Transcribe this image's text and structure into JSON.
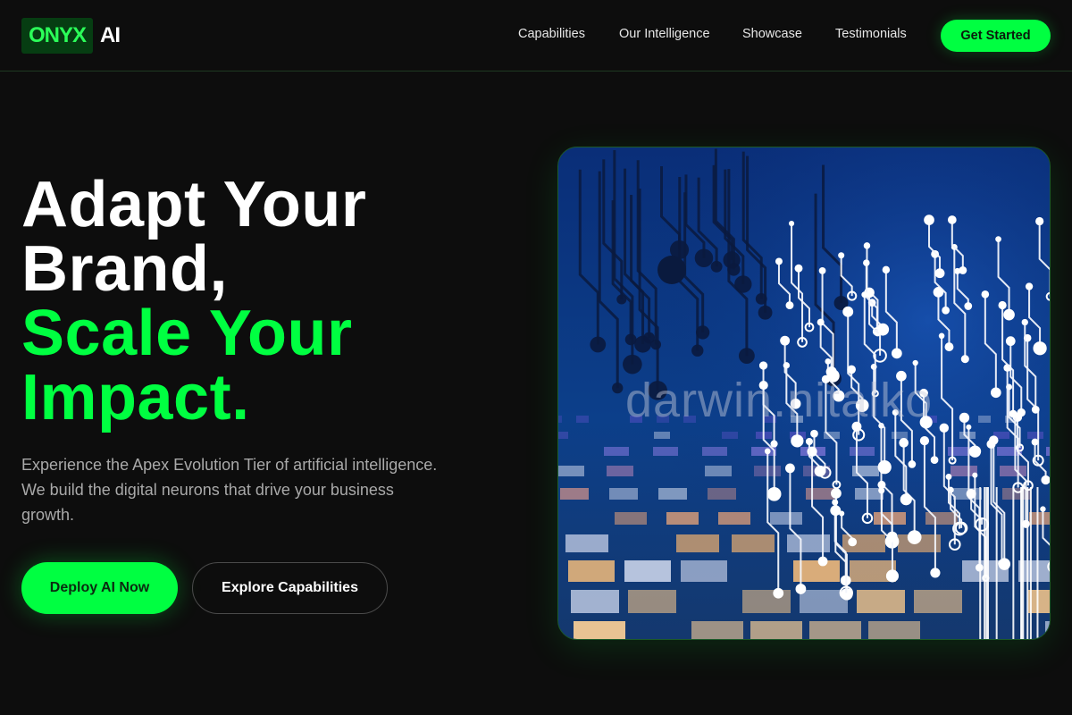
{
  "brand": {
    "logo_primary": "ONYX",
    "logo_secondary": "AI"
  },
  "nav": {
    "links": [
      {
        "label": "Capabilities"
      },
      {
        "label": "Our Intelligence"
      },
      {
        "label": "Showcase"
      },
      {
        "label": "Testimonials"
      }
    ],
    "cta_label": "Get Started"
  },
  "hero": {
    "headline_line1": "Adapt Your",
    "headline_line2": "Brand,",
    "headline_line3": "Scale Your",
    "headline_line4": "Impact.",
    "subtext": "Experience the Apex Evolution Tier of artificial intelligence. We build the digital neurons that drive your business growth.",
    "primary_button": "Deploy AI Now",
    "secondary_button": "Explore Capabilities",
    "image_watermark": "darwin.nitalko"
  },
  "colors": {
    "accent": "#00ff41",
    "background": "#0d0d0d",
    "logo_box": "#063d12",
    "image_bg": "#0c2a66"
  },
  "icons": {
    "hero_image": "circuit-brain-illustration"
  }
}
